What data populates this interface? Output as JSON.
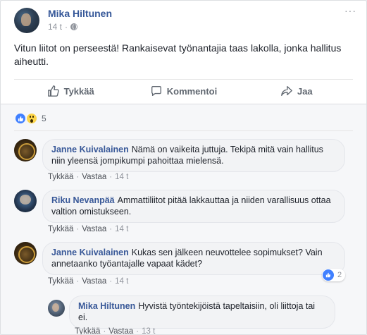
{
  "post": {
    "author": "Mika Hiltunen",
    "time": "14 t",
    "separator": "·",
    "more": "···",
    "text": "Vitun liitot on perseestä! Rankaisevat työnantajia taas lakolla, jonka hallitus aiheutti."
  },
  "actions": {
    "like": "Tykkää",
    "comment": "Kommentoi",
    "share": "Jaa"
  },
  "reactions": {
    "icons": [
      "like-icon",
      "wow-icon"
    ],
    "count": "5"
  },
  "comments": [
    {
      "author": "Janne Kuivalainen",
      "text": "Nämä on vaikeita juttuja. Tekipä mitä vain hallitus niin yleensä jompikumpi pahoittaa mielensä.",
      "like": "Tykkää",
      "reply": "Vastaa",
      "time": "14 t"
    },
    {
      "author": "Riku Nevanpää",
      "text": "Ammattiliitot pitää lakkauttaa ja niiden varallisuus ottaa valtion omistukseen.",
      "like": "Tykkää",
      "reply": "Vastaa",
      "time": "14 t"
    },
    {
      "author": "Janne Kuivalainen",
      "text": "Kukas sen jälkeen neuvottelee sopimukset? Vain annetaanko työantajalle vapaat kädet?",
      "like": "Tykkää",
      "reply": "Vastaa",
      "time": "14 t",
      "reaction_count": "2"
    },
    {
      "author": "Mika Hiltunen",
      "text": "Hyvistä työntekijöistä tapeltaisiin, oli liittoja tai ei.",
      "like": "Tykkää",
      "reply": "Vastaa",
      "time": "13 t"
    }
  ],
  "colors": {
    "link": "#365899",
    "like_blue": "#4080ff",
    "muted": "#90949c"
  }
}
